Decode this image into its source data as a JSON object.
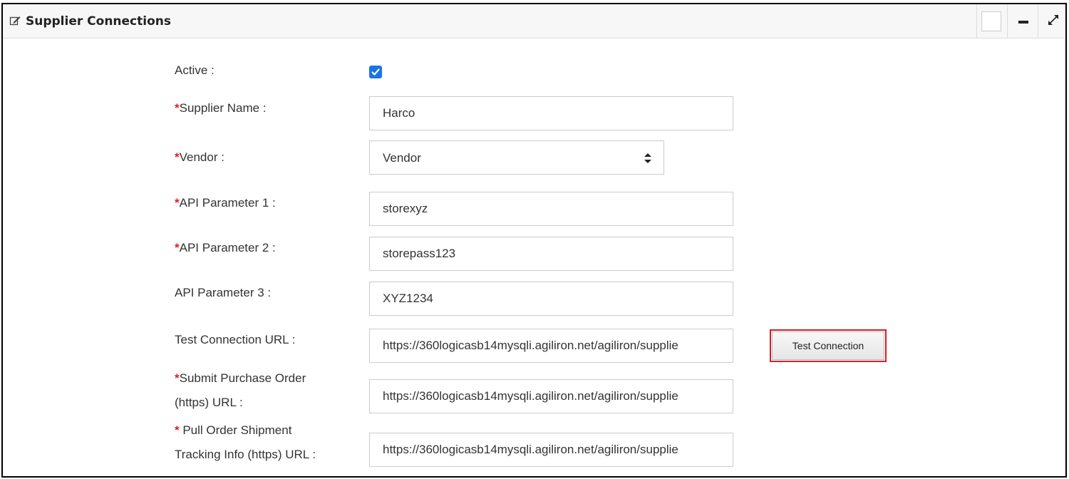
{
  "panel": {
    "title": "Supplier Connections",
    "header_buttons": [
      "blank-square",
      "minimize-icon",
      "expand-icon"
    ]
  },
  "form": {
    "active": {
      "label": "Active :",
      "checked": true
    },
    "supplier_name": {
      "required": true,
      "label": "Supplier Name :",
      "value": "Harco"
    },
    "vendor": {
      "required": true,
      "label": "Vendor :",
      "value": "Vendor"
    },
    "api_param_1": {
      "required": true,
      "label": "API Parameter 1 :",
      "value": "storexyz"
    },
    "api_param_2": {
      "required": true,
      "label": "API Parameter 2 :",
      "value": "storepass123"
    },
    "api_param_3": {
      "required": false,
      "label": "API Parameter 3 :",
      "value": "XYZ1234"
    },
    "test_connection_url": {
      "required": false,
      "label": "Test Connection URL :",
      "value": "https://360logicasb14mysqli.agiliron.net/agiliron/supplie",
      "button_label": "Test Connection"
    },
    "submit_po_url": {
      "required": true,
      "label_line1": "Submit Purchase Order",
      "label_line2": "(https) URL :",
      "value": "https://360logicasb14mysqli.agiliron.net/agiliron/supplie"
    },
    "pull_tracking_url": {
      "required": true,
      "label_line1": " Pull Order Shipment",
      "label_line2": "Tracking Info (https) URL :",
      "value": "https://360logicasb14mysqli.agiliron.net/agiliron/supplie"
    },
    "required_marker": "*"
  },
  "colors": {
    "required": "#e02020",
    "checkbox": "#1a73e8",
    "highlight_border": "#d0202a"
  }
}
